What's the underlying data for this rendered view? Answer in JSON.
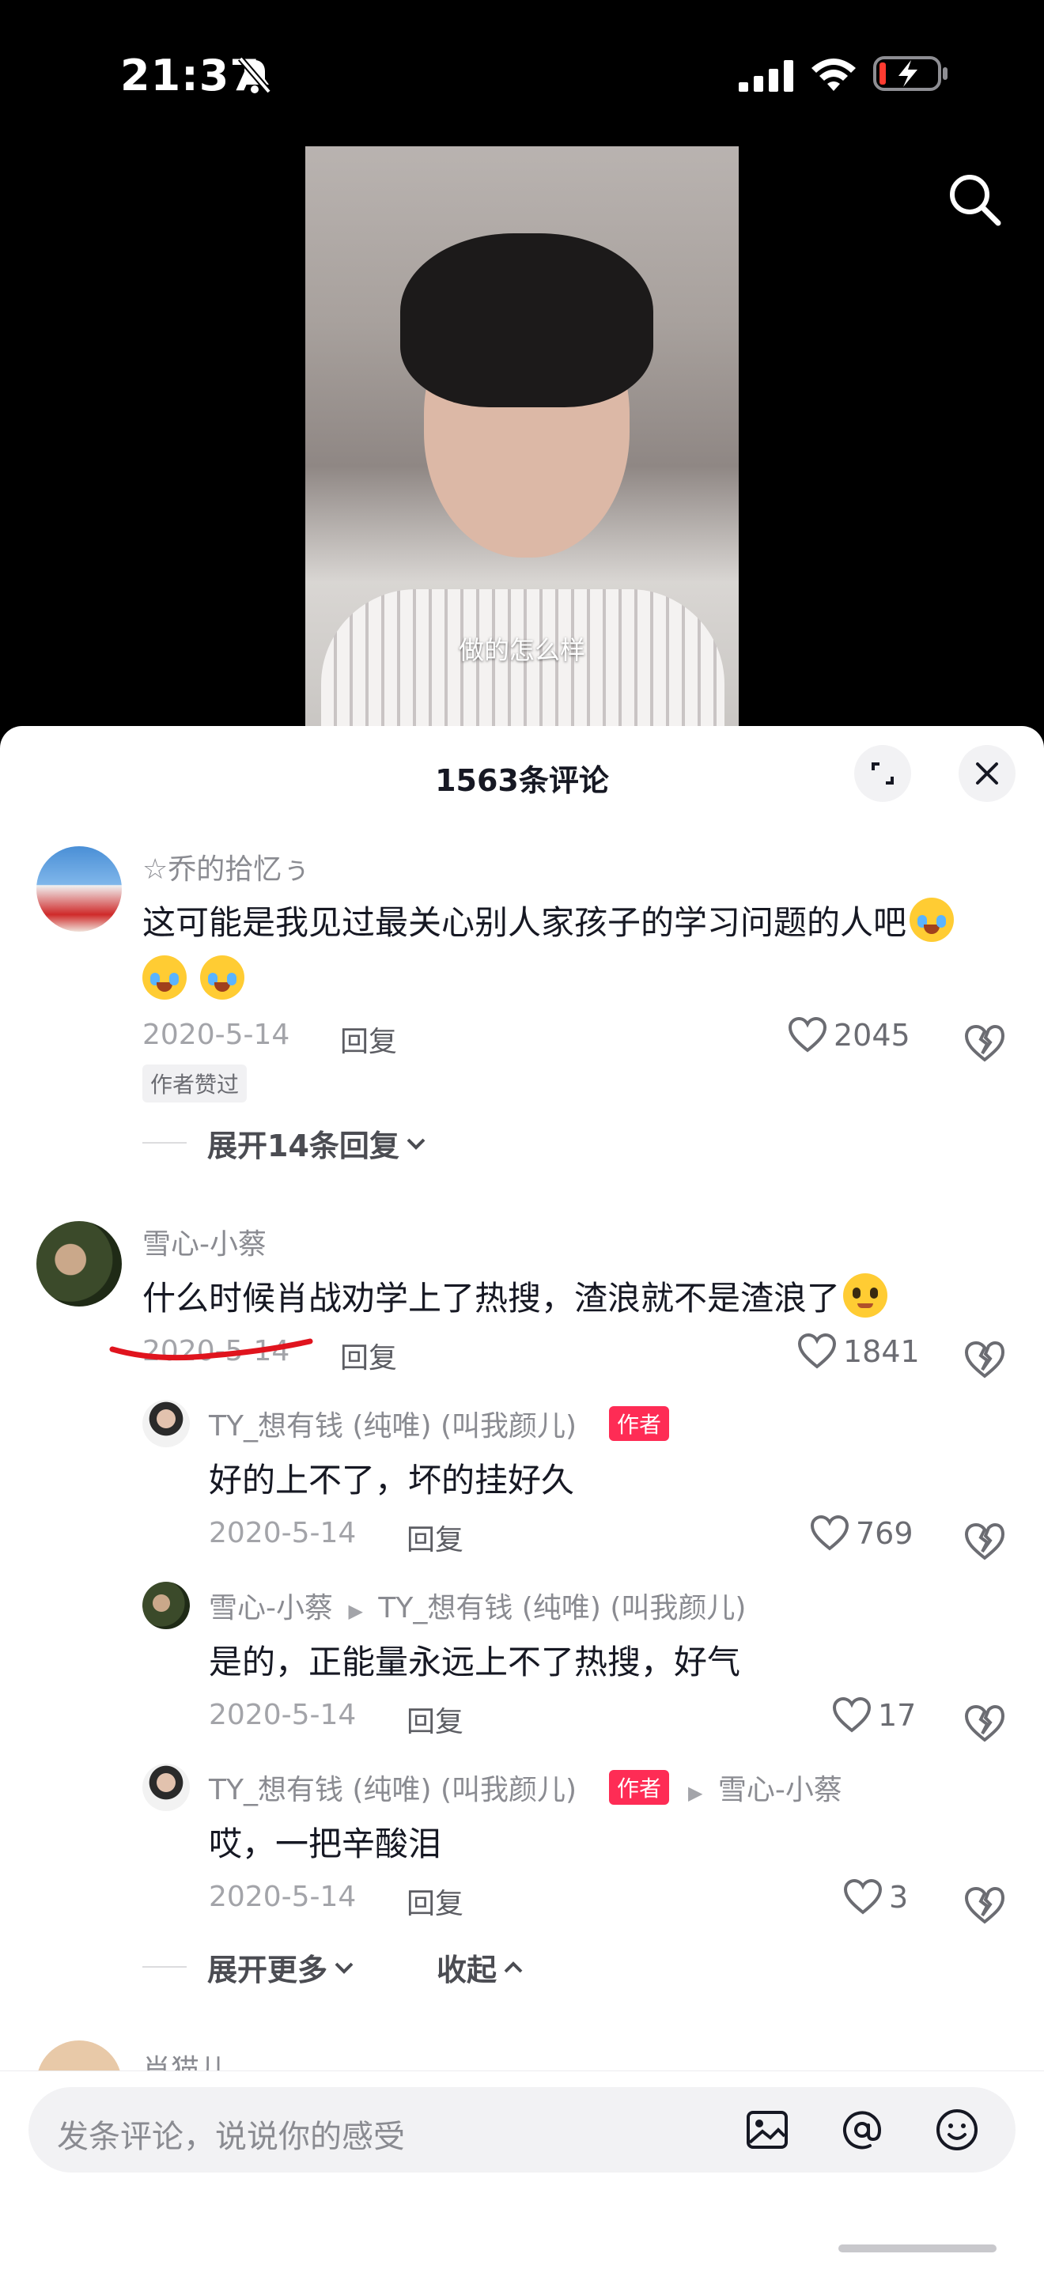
{
  "status": {
    "time": "21:37"
  },
  "video": {
    "subtitle": "做的怎么样"
  },
  "sheet": {
    "title": "1563条评论"
  },
  "comments": [
    {
      "username": "☆乔的拾忆ぅ",
      "text_line1": "这可能是我见过最关心别人家孩子的学习问题的人吧",
      "date": "2020-5-14",
      "reply": "回复",
      "likes": "2045",
      "badge": "作者赞过",
      "expand": "展开14条回复"
    },
    {
      "username": "雪心-小蔡",
      "text": "什么时候肖战劝学上了热搜，渣浪就不是渣浪了",
      "date": "2020-5-14",
      "reply": "回复",
      "likes": "1841"
    }
  ],
  "replies": [
    {
      "username": "TY_想有钱 (纯唯) (叫我颜儿)",
      "badge": "作者",
      "text": "好的上不了，坏的挂好久",
      "date": "2020-5-14",
      "reply": "回复",
      "likes": "769"
    },
    {
      "username": "雪心-小蔡",
      "reply_to": "TY_想有钱 (纯唯) (叫我颜儿)",
      "text": "是的，正能量永远上不了热搜，好气",
      "date": "2020-5-14",
      "reply": "回复",
      "likes": "17"
    },
    {
      "username": "TY_想有钱 (纯唯) (叫我颜儿)",
      "badge": "作者",
      "reply_to": "雪心-小蔡",
      "text": "哎，一把辛酸泪",
      "date": "2020-5-14",
      "reply": "回复",
      "likes": "3"
    }
  ],
  "thread_controls": {
    "expand_more": "展开更多",
    "collapse": "收起"
  },
  "peek": {
    "username": "肖猫儿"
  },
  "input": {
    "placeholder": "发条评论，说说你的感受"
  },
  "colors": {
    "accent": "#fe2c55",
    "underline": "#e0141e"
  }
}
